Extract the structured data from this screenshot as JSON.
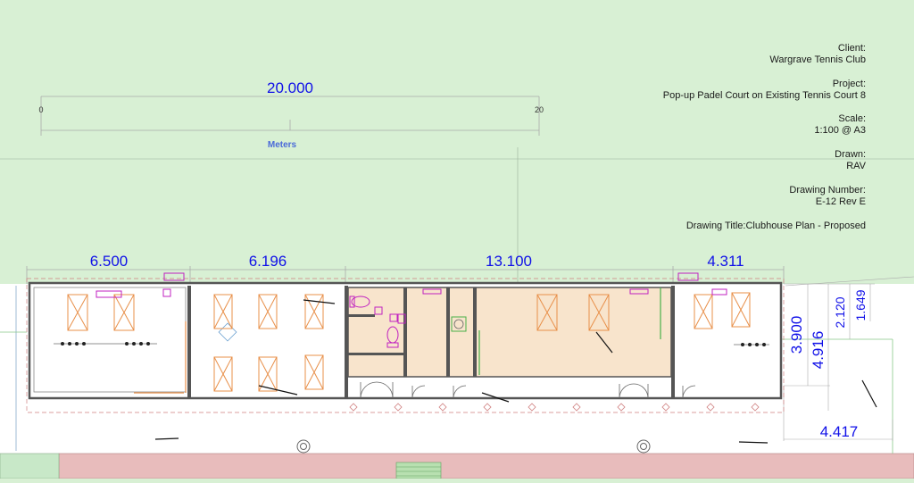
{
  "title_block": {
    "client_label": "Client:",
    "client": "Wargrave Tennis Club",
    "project_label": "Project:",
    "project": "Pop-up Padel Court on Existing Tennis Court 8",
    "scale_label": "Scale:",
    "scale": "1:100 @ A3",
    "drawn_label": "Drawn:",
    "drawn": "RAV",
    "drawing_number_label": "Drawing Number:",
    "drawing_number": "E-12 Rev E",
    "drawing_title": "Drawing Title:Clubhouse Plan - Proposed"
  },
  "scale_bar": {
    "length_label": "20.000",
    "start_tick": "0",
    "end_tick": "20",
    "unit": "Meters"
  },
  "dimensions": {
    "top": [
      "6.500",
      "6.196",
      "13.100",
      "4.311"
    ],
    "right_vertical": [
      "3.900",
      "4.916",
      "2.120",
      "1.649"
    ],
    "bottom_right": "4.417"
  },
  "colors": {
    "background_green": "#d8f0d4",
    "paving_red": "#e8bcbc",
    "interior_beige": "#f8e4cc",
    "dimension_blue": "#1010e8",
    "furniture_orange": "#e8904a",
    "fixture_magenta": "#c020c0"
  }
}
